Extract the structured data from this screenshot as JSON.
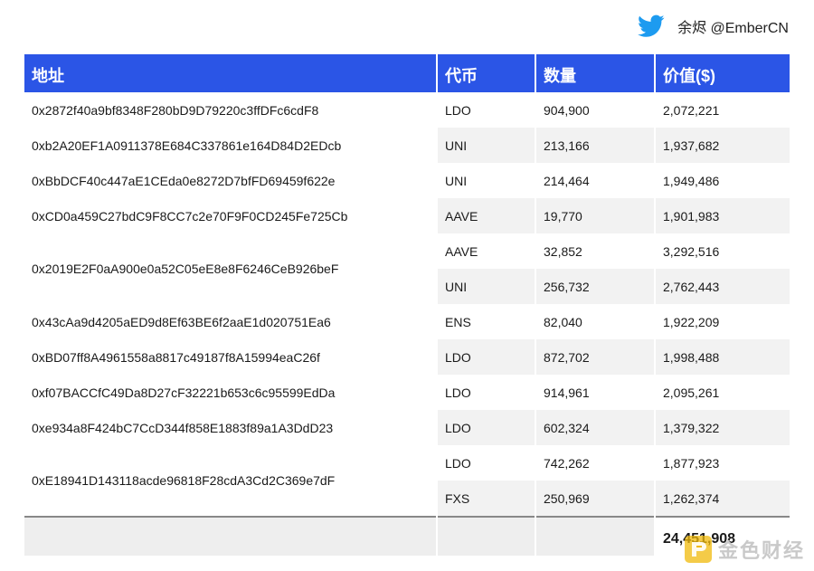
{
  "header": {
    "author": "余烬 @EmberCN",
    "icon": "twitter-bird-icon",
    "icon_color": "#1d9bf0"
  },
  "table": {
    "header_color": "#2b55e6",
    "columns": [
      "地址",
      "代币",
      "数量",
      "价值($)"
    ],
    "rows": [
      {
        "address": "0x2872f40a9bf8348F280bD9D79220c3ffDFc6cdF8",
        "holdings": [
          {
            "token": "LDO",
            "amount": "904,900",
            "value": "2,072,221"
          }
        ]
      },
      {
        "address": "0xb2A20EF1A0911378E684C337861e164D84D2EDcb",
        "holdings": [
          {
            "token": "UNI",
            "amount": "213,166",
            "value": "1,937,682"
          }
        ]
      },
      {
        "address": "0xBbDCF40c447aE1CEda0e8272D7bfFD69459f622e",
        "holdings": [
          {
            "token": "UNI",
            "amount": "214,464",
            "value": "1,949,486"
          }
        ]
      },
      {
        "address": "0xCD0a459C27bdC9F8CC7c2e70F9F0CD245Fe725Cb",
        "holdings": [
          {
            "token": "AAVE",
            "amount": "19,770",
            "value": "1,901,983"
          }
        ]
      },
      {
        "address": "0x2019E2F0aA900e0a52C05eE8e8F6246CeB926beF",
        "holdings": [
          {
            "token": "AAVE",
            "amount": "32,852",
            "value": "3,292,516"
          },
          {
            "token": "UNI",
            "amount": "256,732",
            "value": "2,762,443"
          }
        ]
      },
      {
        "address": "0x43cAa9d4205aED9d8Ef63BE6f2aaE1d020751Ea6",
        "holdings": [
          {
            "token": "ENS",
            "amount": "82,040",
            "value": "1,922,209"
          }
        ]
      },
      {
        "address": "0xBD07ff8A4961558a8817c49187f8A15994eaC26f",
        "holdings": [
          {
            "token": "LDO",
            "amount": "872,702",
            "value": "1,998,488"
          }
        ]
      },
      {
        "address": "0xf07BACCfC49Da8D27cF32221b653c6c95599EdDa",
        "holdings": [
          {
            "token": "LDO",
            "amount": "914,961",
            "value": "2,095,261"
          }
        ]
      },
      {
        "address": "0xe934a8F424bC7CcD344f858E1883f89a1A3DdD23",
        "holdings": [
          {
            "token": "LDO",
            "amount": "602,324",
            "value": "1,379,322"
          }
        ]
      },
      {
        "address": "0xE18941D143118acde96818F28cdA3Cd2C369e7dF",
        "holdings": [
          {
            "token": "LDO",
            "amount": "742,262",
            "value": "1,877,923"
          },
          {
            "token": "FXS",
            "amount": "250,969",
            "value": "1,262,374"
          }
        ]
      }
    ],
    "total": "24,451,908"
  },
  "watermark": {
    "text": "金色财经",
    "icon": "jinse-logo-icon",
    "color": "#f0b90b"
  }
}
